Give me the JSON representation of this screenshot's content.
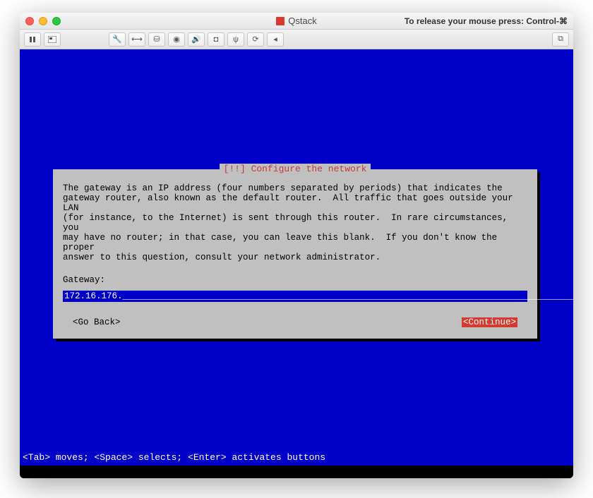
{
  "window": {
    "title": "Qstack",
    "mouse_hint": "To release your mouse press: Control-⌘"
  },
  "toolbar": {
    "icons": {
      "pause": "pause-icon",
      "snapshot": "snapshot-icon",
      "wrench": "wrench-icon",
      "network": "network-icon",
      "hdd": "hdd-icon",
      "cd": "cd-icon",
      "audio": "audio-icon",
      "camera": "camera-icon",
      "usb": "usb-icon",
      "shared": "shared-icon",
      "mouse": "mouse-icon",
      "fullscreen": "fullscreen-icon"
    }
  },
  "dialog": {
    "title": "[!!] Configure the network",
    "body": "The gateway is an IP address (four numbers separated by periods) that indicates the\ngateway router, also known as the default router.  All traffic that goes outside your LAN\n(for instance, to the Internet) is sent through this router.  In rare circumstances, you\nmay have no router; in that case, you can leave this blank.  If you don't know the proper\nanswer to this question, consult your network administrator.",
    "field_label": "Gateway:",
    "input_value": "172.16.176.",
    "input_fill": "_______________________________________________________________________________________",
    "go_back": "<Go Back>",
    "continue": "<Continue>"
  },
  "footer": {
    "hint": "<Tab> moves; <Space> selects; <Enter> activates buttons"
  }
}
